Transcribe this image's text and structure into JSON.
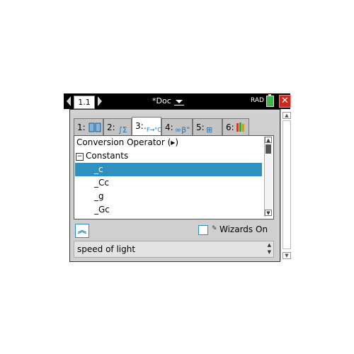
{
  "window": {
    "page_tab": "1.1",
    "doc_title": "*Doc",
    "angle_mode": "RAD",
    "close_symbol": "✕",
    "accent_color": "#2f91c0"
  },
  "catalog": {
    "tabs": [
      {
        "number": "1:",
        "icon": "book-icon"
      },
      {
        "number": "2:",
        "icon": "integral-sum-icon",
        "glyph": "∫Σ"
      },
      {
        "number": "3:",
        "icon": "unit-conversion-icon",
        "glyph": "°F→°C"
      },
      {
        "number": "4:",
        "icon": "symbols-icon",
        "glyph": "∞β°"
      },
      {
        "number": "5:",
        "icon": "library-icon",
        "glyph": "⊞"
      },
      {
        "number": "6:",
        "icon": "books-icon"
      }
    ],
    "active_tab_index": 2,
    "list": {
      "rows": [
        {
          "label": "Conversion Operator (▸)"
        },
        {
          "label": "Constants"
        },
        {
          "label": "_c"
        },
        {
          "label": "_Cc"
        },
        {
          "label": "_g"
        },
        {
          "label": "_Gc"
        }
      ],
      "selected_index": 2
    },
    "wizards_label": "Wizards On",
    "wizards_checked": false,
    "help_text": "speed of light"
  }
}
